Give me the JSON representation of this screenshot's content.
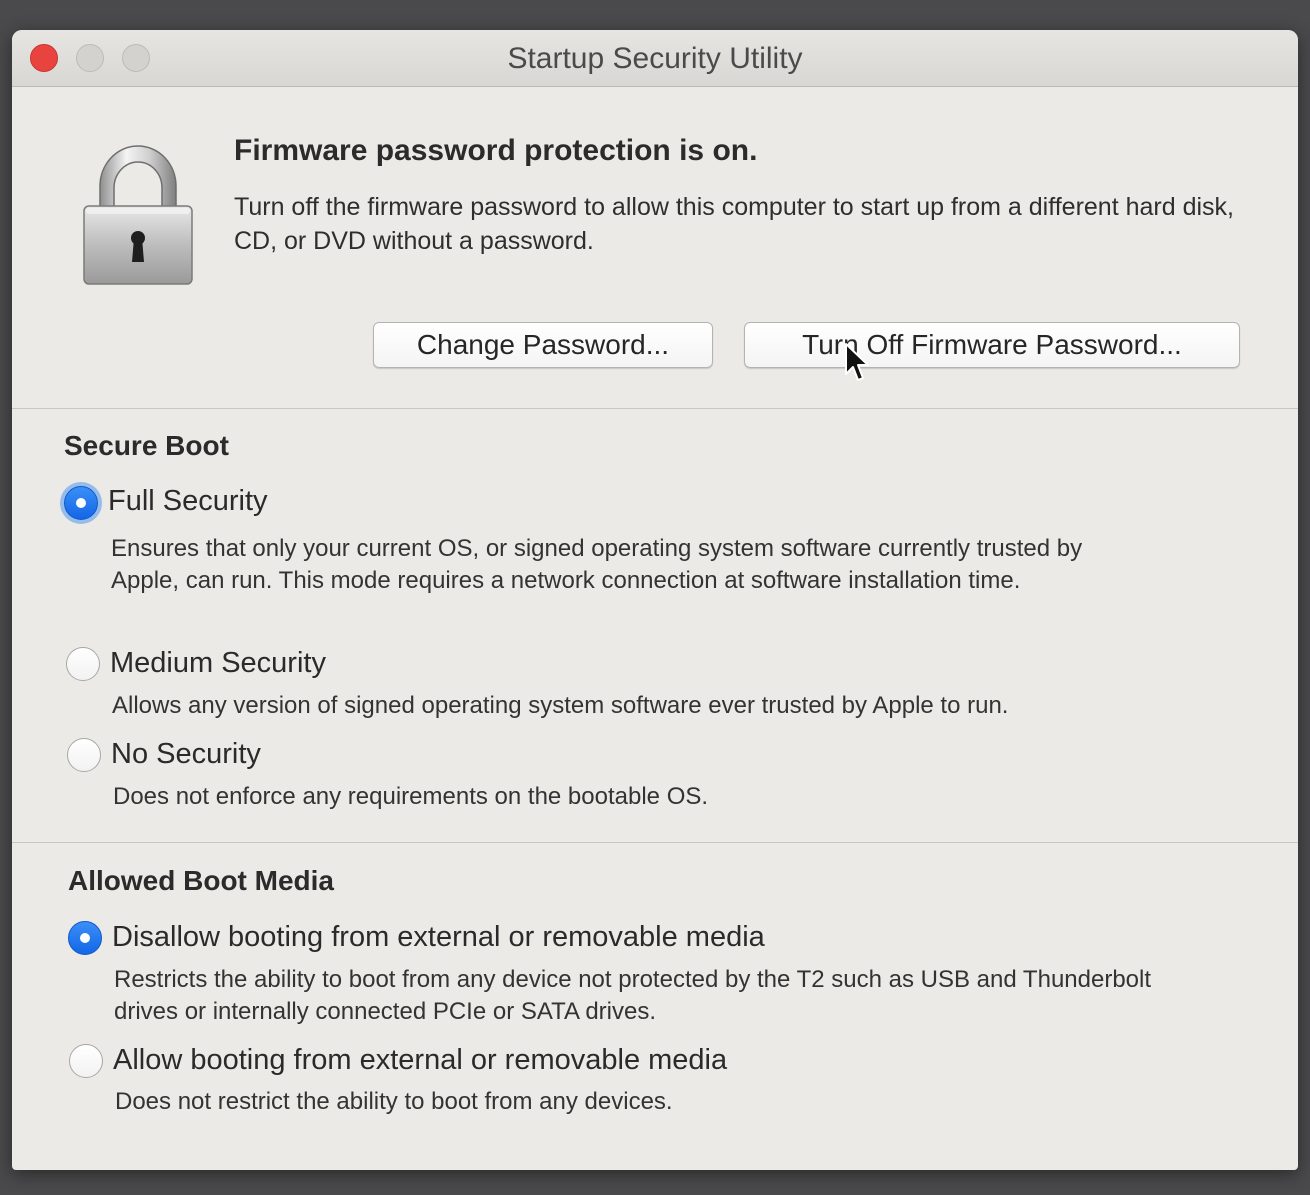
{
  "window": {
    "title": "Startup Security Utility"
  },
  "firmware": {
    "icon": "padlock-icon",
    "headline": "Firmware password protection is on.",
    "description": "Turn off the firmware password to allow this computer to start up from a different hard disk, CD, or DVD without a password.",
    "change_password_label": "Change Password...",
    "turn_off_label": "Turn Off Firmware Password..."
  },
  "secure_boot": {
    "title": "Secure Boot",
    "options": [
      {
        "label": "Full Security",
        "description": "Ensures that only your current OS, or signed operating system software currently trusted by Apple, can run. This mode requires a network connection at software installation time.",
        "selected": true
      },
      {
        "label": "Medium Security",
        "description": "Allows any version of signed operating system software ever trusted by Apple to run.",
        "selected": false
      },
      {
        "label": "No Security",
        "description": "Does not enforce any requirements on the bootable OS.",
        "selected": false
      }
    ]
  },
  "boot_media": {
    "title": "Allowed Boot Media",
    "options": [
      {
        "label": "Disallow booting from external or removable media",
        "description": "Restricts the ability to boot from any device not protected by the T2 such as USB and Thunderbolt drives or internally connected PCIe or SATA drives.",
        "selected": true
      },
      {
        "label": "Allow booting from external or removable media",
        "description": "Does not restrict the ability to boot from any devices.",
        "selected": false
      }
    ]
  },
  "colors": {
    "accent": "#1a6ff0",
    "close_button": "#e9433f",
    "window_bg": "#eceae6"
  }
}
